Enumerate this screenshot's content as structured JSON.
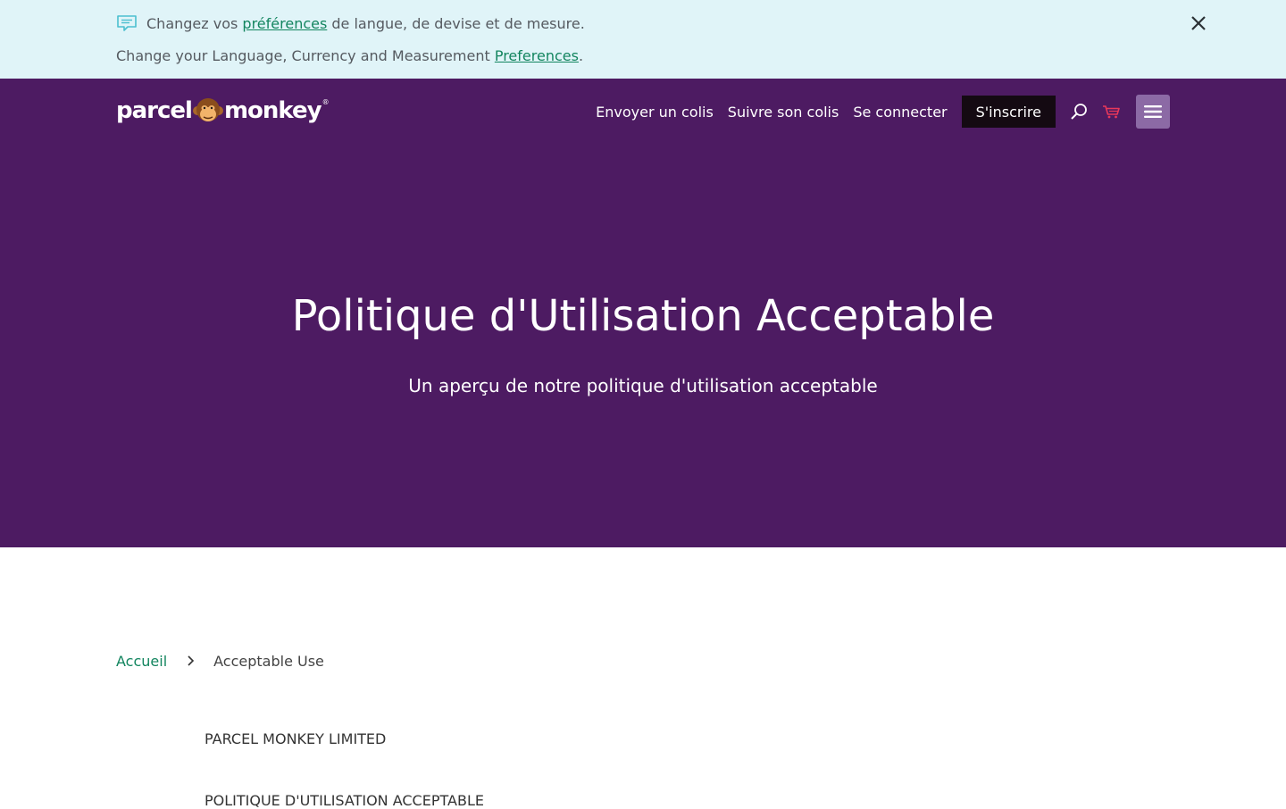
{
  "notice": {
    "line1_prefix": "Changez vos ",
    "line1_link": "préférences",
    "line1_suffix": " de langue, de devise et de mesure.",
    "line2_prefix": "Change your Language, Currency and Measurement ",
    "line2_link": "Preferences",
    "line2_suffix": "."
  },
  "header": {
    "logo_left": "parcel",
    "logo_right": "monkey",
    "logo_mark": "®",
    "nav": {
      "send": "Envoyer un colis",
      "track": "Suivre son colis",
      "login": "Se connecter",
      "signup": "S'inscrire"
    },
    "icons": [
      "search-icon",
      "cart-icon",
      "menu-icon"
    ]
  },
  "hero": {
    "title": "Politique d'Utilisation Acceptable",
    "subtitle": "Un aperçu de notre politique d'utilisation acceptable"
  },
  "breadcrumb": {
    "home": "Accueil",
    "current": "Acceptable Use"
  },
  "document": {
    "company": "PARCEL MONKEY LIMITED",
    "heading": "POLITIQUE D'UTILISATION ACCEPTABLE"
  },
  "colors": {
    "banner_bg": "#e0f4f8",
    "hero_bg": "#4d1b62",
    "link_green": "#13855f",
    "signup_bg": "#140a12",
    "menu_bg": "#8c6aa5",
    "cart_red": "#e8385a"
  }
}
